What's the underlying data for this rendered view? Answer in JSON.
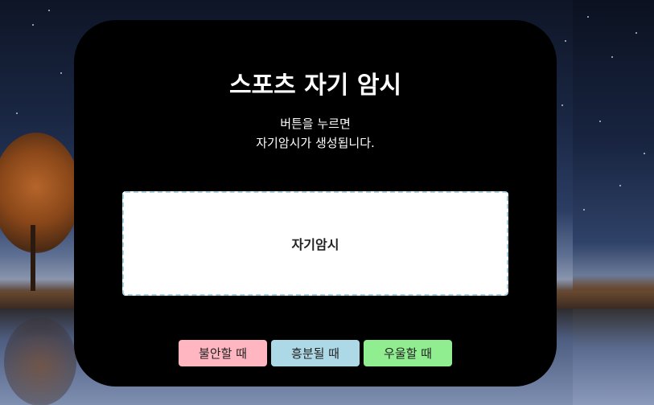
{
  "page": {
    "title": "스포츠 자기 암시",
    "instruction_line1": "버튼을 누르면",
    "instruction_line2": "자기암시가 생성됩니다.",
    "affirmation": "자기암시"
  },
  "buttons": {
    "anxious": {
      "label": "불안할 때",
      "color": "#ffb6c1"
    },
    "excited": {
      "label": "흥분될 때",
      "color": "#add8e6"
    },
    "depressed": {
      "label": "우울할 때",
      "color": "#90ee90"
    }
  },
  "colors": {
    "card_background": "#000000",
    "box_border": "#a8cfe0"
  },
  "background": {
    "icon": "night-sky-lake-tree-photo"
  }
}
